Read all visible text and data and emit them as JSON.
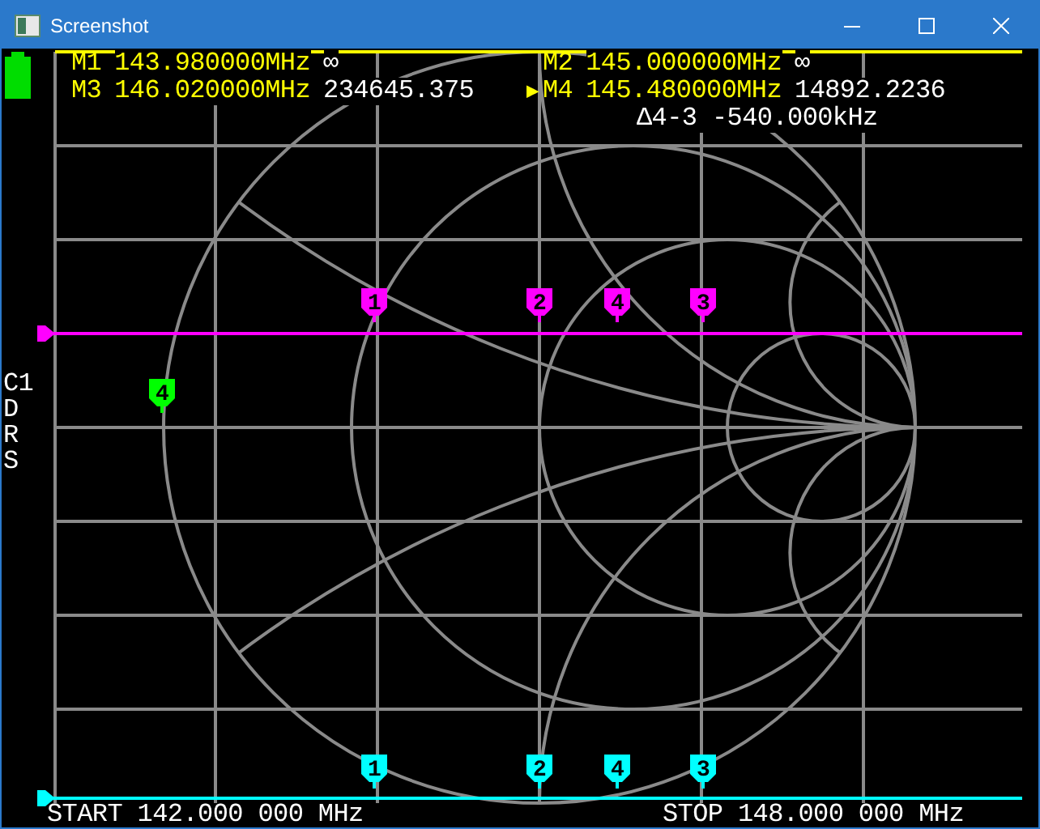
{
  "window": {
    "title": "Screenshot"
  },
  "readouts": [
    {
      "label": "M1",
      "frequency": "143.980000MHz",
      "value": "∞",
      "selected": false
    },
    {
      "label": "M2",
      "frequency": "145.000000MHz",
      "value": "∞",
      "selected": false
    },
    {
      "label": "M3",
      "frequency": "146.020000MHz",
      "value": "234645.375",
      "selected": false
    },
    {
      "label": "M4",
      "frequency": "145.480000MHz",
      "value": "14892.2236",
      "selected": true
    }
  ],
  "active_marker_symbol": "▶",
  "delta": "Δ4-3 -540.000kHz",
  "channel": {
    "label": "C1",
    "formats": [
      "D",
      "R",
      "S"
    ]
  },
  "traces": [
    {
      "color": "#ff00ff",
      "markers": [
        "1",
        "2",
        "4",
        "3"
      ]
    },
    {
      "color": "#00ffff",
      "markers": [
        "1",
        "2",
        "4",
        "3"
      ]
    },
    {
      "color": "#00ff00",
      "markers": [
        "4"
      ]
    }
  ],
  "sweep": {
    "start": "START 142.000 000 MHz",
    "stop": "STOP 148.000 000 MHz"
  }
}
